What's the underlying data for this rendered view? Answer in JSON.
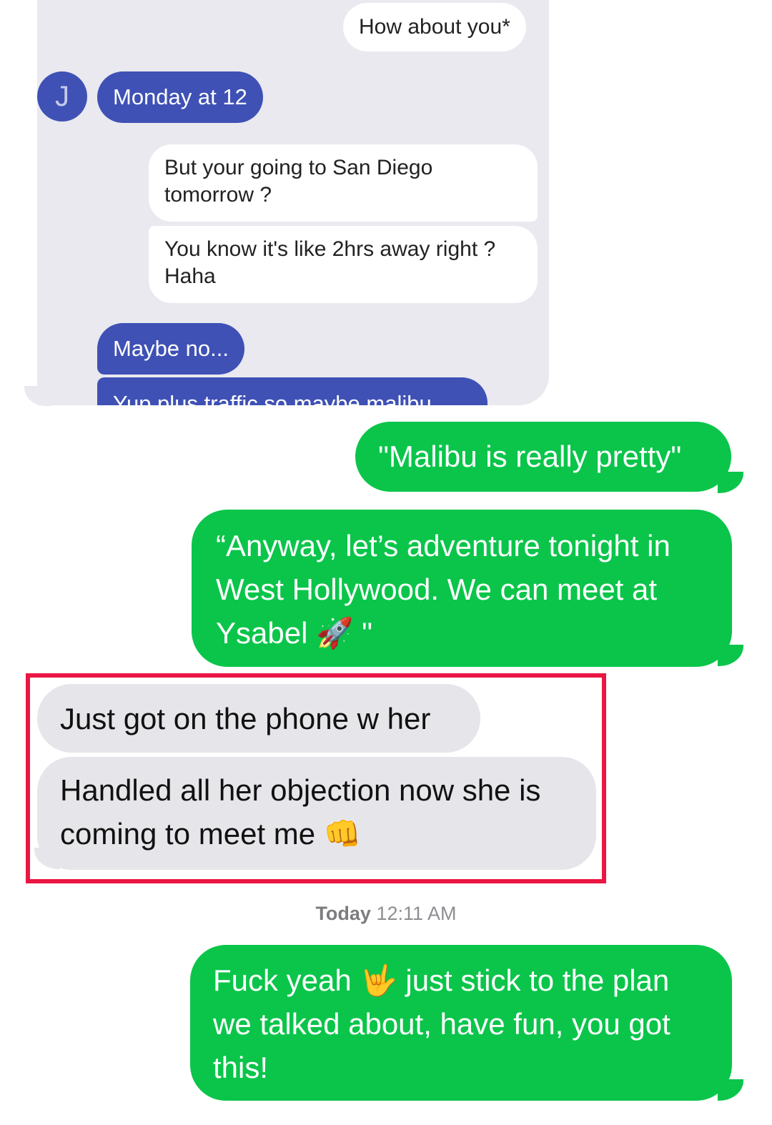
{
  "embedded_chat": {
    "avatar_initial": "J",
    "messages": [
      {
        "sender": "me",
        "text": "How about you*"
      },
      {
        "sender": "them",
        "text": "Monday at 12"
      },
      {
        "sender": "me",
        "text": "But your going to San Diego tomorrow ?"
      },
      {
        "sender": "me",
        "text": "You know it's like 2hrs away right ? Haha"
      },
      {
        "sender": "them",
        "text": "Maybe no..."
      },
      {
        "sender": "them",
        "text": "Yup plus traffic so maybe malibu"
      }
    ]
  },
  "messages": [
    {
      "sender": "me",
      "text": "\"Malibu is really pretty\""
    },
    {
      "sender": "me",
      "line1": "“Anyway, let’s adventure tonight in",
      "line2": "West Hollywood. We can meet at",
      "line3": "Ysabel",
      "emoji": "🚀",
      "tail": "\""
    },
    {
      "sender": "them",
      "text": "Just got on the phone w her"
    },
    {
      "sender": "them",
      "line1": "Handled all her objection now she is",
      "line2": "coming to meet me",
      "emoji": "👊"
    },
    {
      "sender": "me",
      "line1a": "Fuck yeah",
      "emoji": "🤟",
      "line1b": "just stick to the plan",
      "line2": "we talked about, have fun, you got",
      "line3": "this!"
    }
  ],
  "timestamp": {
    "day": "Today",
    "time": "12:11 AM"
  },
  "colors": {
    "sent": "#0ac54a",
    "received": "#e6e6ea",
    "embedded_blue": "#3f51b5",
    "highlight": "#ea1643"
  }
}
